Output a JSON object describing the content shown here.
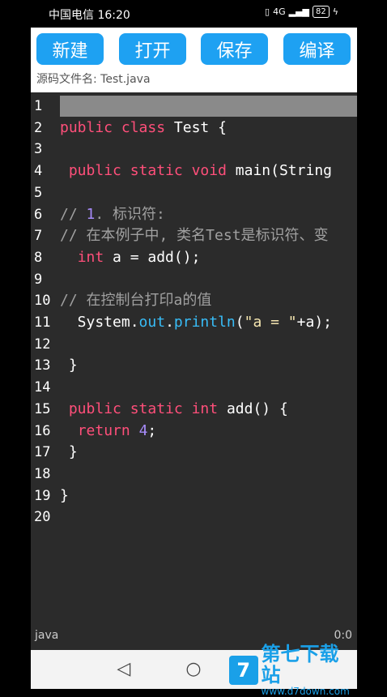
{
  "status": {
    "carrier_time": "中国电信 16:20",
    "signal": "4G",
    "battery": "82"
  },
  "toolbar": {
    "new_label": "新建",
    "open_label": "打开",
    "save_label": "保存",
    "compile_label": "编译"
  },
  "file": {
    "label": "源码文件名: Test.java"
  },
  "editor": {
    "lines": [
      {
        "n": "1",
        "code": ""
      },
      {
        "n": "2",
        "code": "public class Test {"
      },
      {
        "n": "3",
        "code": ""
      },
      {
        "n": "4",
        "code": " public static void main(String"
      },
      {
        "n": "5",
        "code": ""
      },
      {
        "n": "6",
        "code": "// 1. 标识符:"
      },
      {
        "n": "7",
        "code": "// 在本例子中, 类名Test是标识符、变"
      },
      {
        "n": "8",
        "code": "  int a = add();"
      },
      {
        "n": "9",
        "code": ""
      },
      {
        "n": "10",
        "code": "// 在控制台打印a的值"
      },
      {
        "n": "11",
        "code": "  System.out.println(\"a = \"+a);"
      },
      {
        "n": "12",
        "code": ""
      },
      {
        "n": "13",
        "code": " }"
      },
      {
        "n": "14",
        "code": ""
      },
      {
        "n": "15",
        "code": " public static int add() {"
      },
      {
        "n": "16",
        "code": "  return 4;"
      },
      {
        "n": "17",
        "code": " }"
      },
      {
        "n": "18",
        "code": ""
      },
      {
        "n": "19",
        "code": "}"
      },
      {
        "n": "20",
        "code": ""
      }
    ]
  },
  "footer": {
    "language": "java",
    "cursor": "0:0"
  },
  "nav": {
    "back_icon": "◁",
    "home_icon": "○"
  },
  "watermark": {
    "logo": "7",
    "main": "第七下载站",
    "sub": "www.d7down.com"
  },
  "colors": {
    "button": "#1ea1f2",
    "keyword": "#ff4f7a",
    "comment": "#a0a0a0",
    "number": "#a78bfa",
    "method": "#38bdf8"
  }
}
